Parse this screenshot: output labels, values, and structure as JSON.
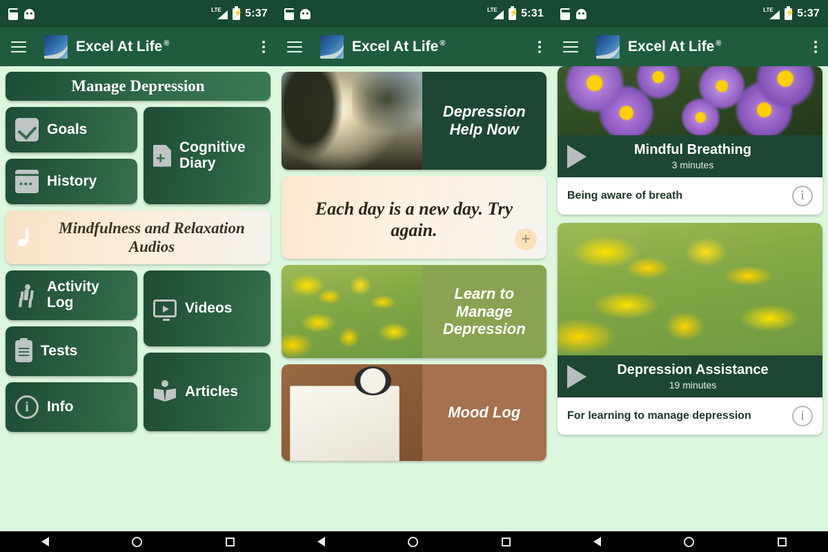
{
  "app": {
    "title": "Excel At Life",
    "trademark": "®"
  },
  "icons": {
    "menu": "hamburger-icon",
    "overflow": "kebab-menu-icon",
    "sd": "sd-card-icon",
    "android": "android-head-icon",
    "signal": "lte-signal-icon",
    "battery": "battery-charging-icon",
    "logo": "excel-at-life-logo"
  },
  "panels": [
    {
      "status": {
        "time": "5:37",
        "network": "LTE"
      },
      "type": "menu",
      "section_title": "Manage Depression",
      "tiles": [
        {
          "label": "Goals",
          "icon": "checkbox-icon"
        },
        {
          "label": "History",
          "icon": "calendar-icon"
        },
        {
          "label": "Cognitive Diary",
          "icon": "document-add-icon"
        },
        {
          "label": "Activity Log",
          "icon": "walking-person-icon"
        },
        {
          "label": "Tests",
          "icon": "clipboard-icon"
        },
        {
          "label": "Info",
          "icon": "info-circle-icon"
        },
        {
          "label": "Videos",
          "icon": "video-monitor-icon"
        },
        {
          "label": "Articles",
          "icon": "book-reader-icon"
        }
      ],
      "audio_banner": {
        "label": "Mindfulness and Relaxation Audios",
        "icon": "music-note-icon"
      }
    },
    {
      "status": {
        "time": "5:31",
        "network": "LTE"
      },
      "type": "feature-cards",
      "cards": [
        {
          "label": "Depression Help Now",
          "photo": "misty-sunrise-road",
          "side_color": "#1e4634"
        },
        {
          "label": "Learn to Manage Depression",
          "photo": "yellow-wildflower-meadow",
          "side_color": "#8aa352"
        },
        {
          "label": "Mood Log",
          "photo": "journal-and-coffee",
          "side_color": "#a5714f"
        }
      ],
      "quote": {
        "text": "Each day is a new day. Try again.",
        "add_label": "+"
      }
    },
    {
      "status": {
        "time": "5:37",
        "network": "LTE"
      },
      "type": "audio-list",
      "items": [
        {
          "title": "Mindful Breathing",
          "duration": "3 minutes",
          "description": "Being aware of breath",
          "photo": "purple-aster-flowers",
          "play_icon": "play-icon",
          "info_icon": "info-icon"
        },
        {
          "title": "Depression Assistance",
          "duration": "19 minutes",
          "description": "For learning to manage depression",
          "photo": "yellow-wildflower-meadow",
          "play_icon": "play-icon",
          "info_icon": "info-icon"
        }
      ]
    }
  ],
  "navbar": {
    "back": "back-triangle",
    "home": "home-circle",
    "recents": "recents-square"
  },
  "colors": {
    "status_bar": "#184a33",
    "app_bar": "#1f5c3f",
    "panel_bg": "#ddf6de",
    "tile_green": "#2b6043",
    "accent_peach": "#fbe7cd"
  }
}
